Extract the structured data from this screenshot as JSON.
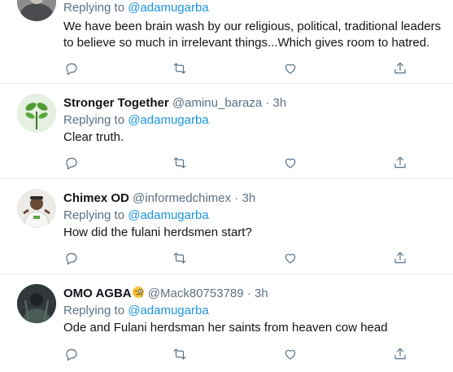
{
  "colors": {
    "mention": "#1b95e0",
    "secondary_text": "#5b7083",
    "primary_text": "#0f1419",
    "divider": "#e6ecf0"
  },
  "reply_prefix": "Replying to",
  "replying_to": "@adamugarba",
  "action_icons": [
    "reply-icon",
    "retweet-icon",
    "like-icon",
    "share-icon"
  ],
  "tweets": [
    {
      "text": "We have been brain wash by our religious, political, traditional leaders to believe so much in irrelevant things...Which gives room to hatred."
    },
    {
      "name": "Stronger Together",
      "handle": "@aminu_baraza",
      "separator": "·",
      "time": "3h",
      "text": "Clear truth."
    },
    {
      "name": "Chimex OD",
      "handle": "@informedchimex",
      "separator": "·",
      "time": "3h",
      "text": "How did the fulani herdsmen start?"
    },
    {
      "name": "OMO AGBA",
      "handle": "@Mack80753789",
      "separator": "·",
      "time": "3h",
      "text": "Ode and Fulani herdsman her saints from heaven cow head"
    }
  ]
}
